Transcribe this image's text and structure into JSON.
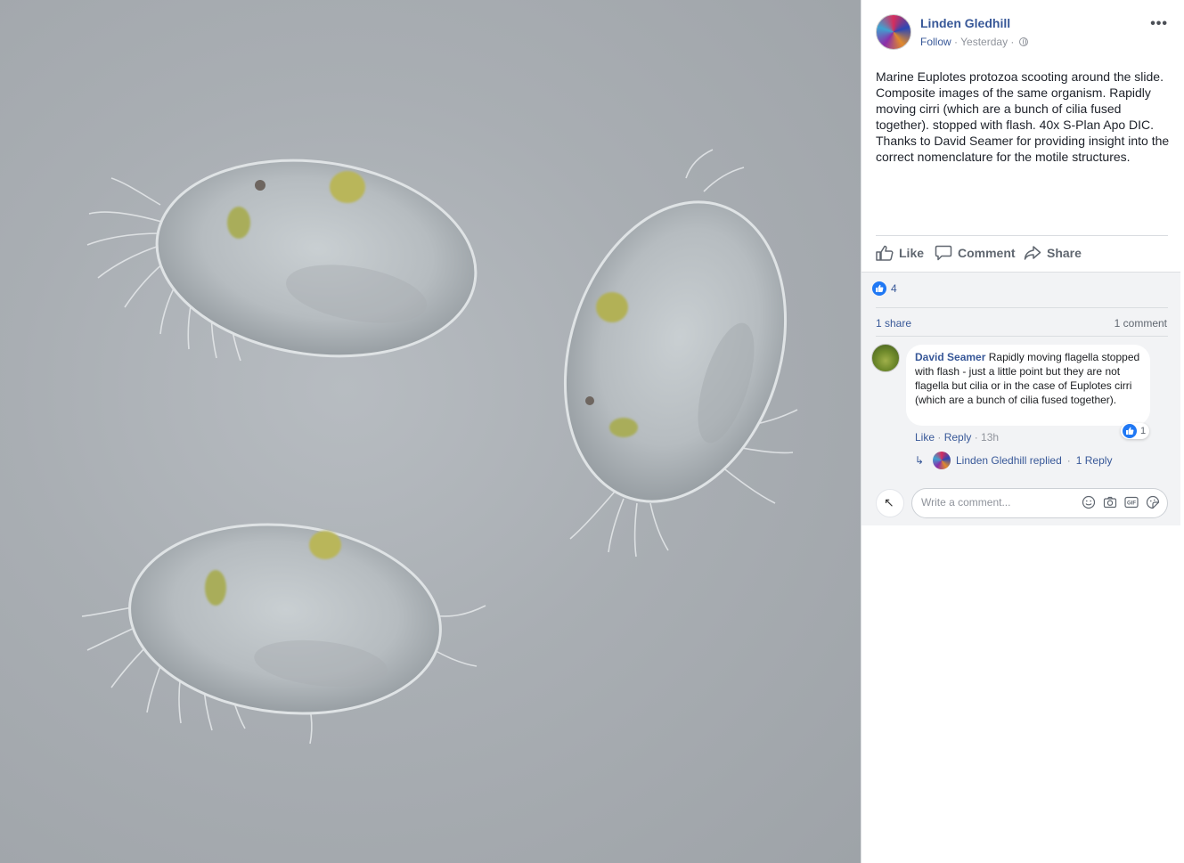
{
  "photo": {
    "subject": "Euplotes protozoa micrograph",
    "background_color": "#a9aeb3"
  },
  "post": {
    "author": "Linden Gledhill",
    "follow_label": "Follow",
    "separator": " · ",
    "timestamp": "Yesterday",
    "text": "Marine Euplotes protozoa scooting around the slide. Composite images of the same organism. Rapidly moving cirri (which are a bunch of cilia fused together). stopped with flash. 40x S-Plan Apo DIC. Thanks to David Seamer for providing insight into the correct nomenclature for the motile structures."
  },
  "actions": {
    "like": "Like",
    "comment": "Comment",
    "share": "Share"
  },
  "stats": {
    "reaction_count": "4",
    "shares": "1 share",
    "comments": "1 comment"
  },
  "comment": {
    "author": "David Seamer",
    "text": "Rapidly moving flagella stopped with flash - just a little point but they are not flagella but cilia or in the case of Euplotes cirri (which are a bunch of cilia fused together).",
    "like_count": "1",
    "like_label": "Like",
    "reply_label": "Reply",
    "time": "13h",
    "dot": " · "
  },
  "reply": {
    "replied_text": "Linden Gledhill replied",
    "count_text": "1 Reply",
    "dot": " · "
  },
  "composer": {
    "placeholder": "Write a comment..."
  },
  "colors": {
    "link": "#385898",
    "like_blue": "#2078f4",
    "feedback_bg": "#f2f3f5"
  }
}
